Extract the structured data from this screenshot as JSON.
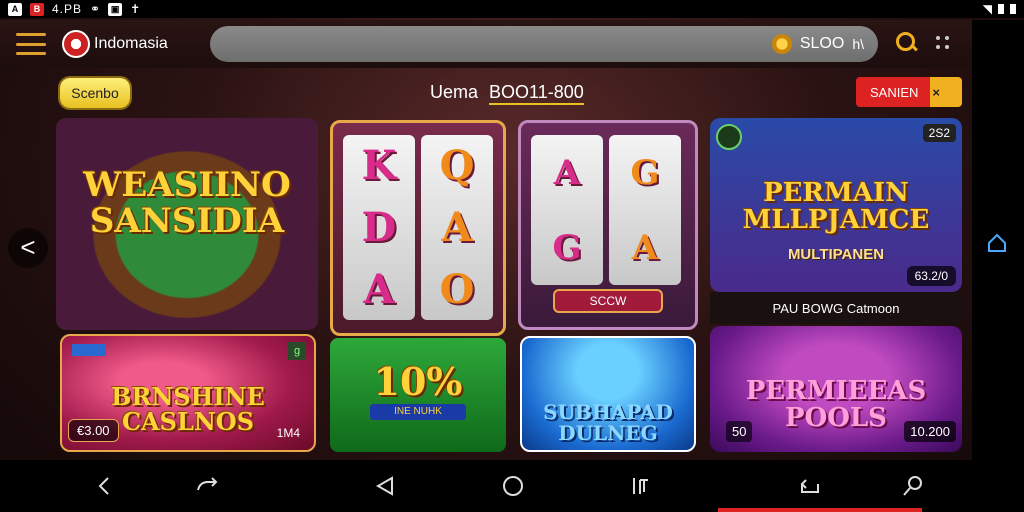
{
  "status_bar": {
    "icon_1": "A",
    "icon_2": "B",
    "text": "4.PB"
  },
  "topbar": {
    "brand_name": "Indomasia",
    "balance": "SLOO",
    "wallet_symbol": "h\\"
  },
  "subbar": {
    "left_pill": "Scenbo",
    "center_label": "Uema",
    "center_amount": "BOO11-800",
    "right_pill": "SANIEN"
  },
  "tiles": {
    "t1_title": "WEASIINO SANSIDIA",
    "t2_reels": [
      [
        "K",
        "D",
        "A"
      ],
      [
        "Q",
        "A",
        "O"
      ]
    ],
    "t3_reels": [
      [
        "A",
        "G"
      ],
      [
        "G",
        "A"
      ]
    ],
    "t3_spin": "SCCW",
    "t4_title": "PERMAIN MLLPJAMCE",
    "t4_sub": "MULTIPANEN",
    "t4_badge": "2S2",
    "t4_price": "63.2/0",
    "t4_caption": "PAU BOWG Catmoon",
    "t5_title": "BRNSHINE CASLNOS",
    "t5_price": "€3.00",
    "t5_tag": "g",
    "t5_num": "1M4",
    "t6_title": "10%",
    "t6_ribbon": "INE NUHK",
    "t7_title": "SUBHAPAD DULNEG",
    "t8_title": "PERMIEEAS POOLS",
    "t8_left": "50",
    "t8_right": "10.200"
  },
  "navigation": {
    "back": "<"
  },
  "colors": {
    "accent_gold": "#f0b020",
    "accent_red": "#dd2222"
  }
}
